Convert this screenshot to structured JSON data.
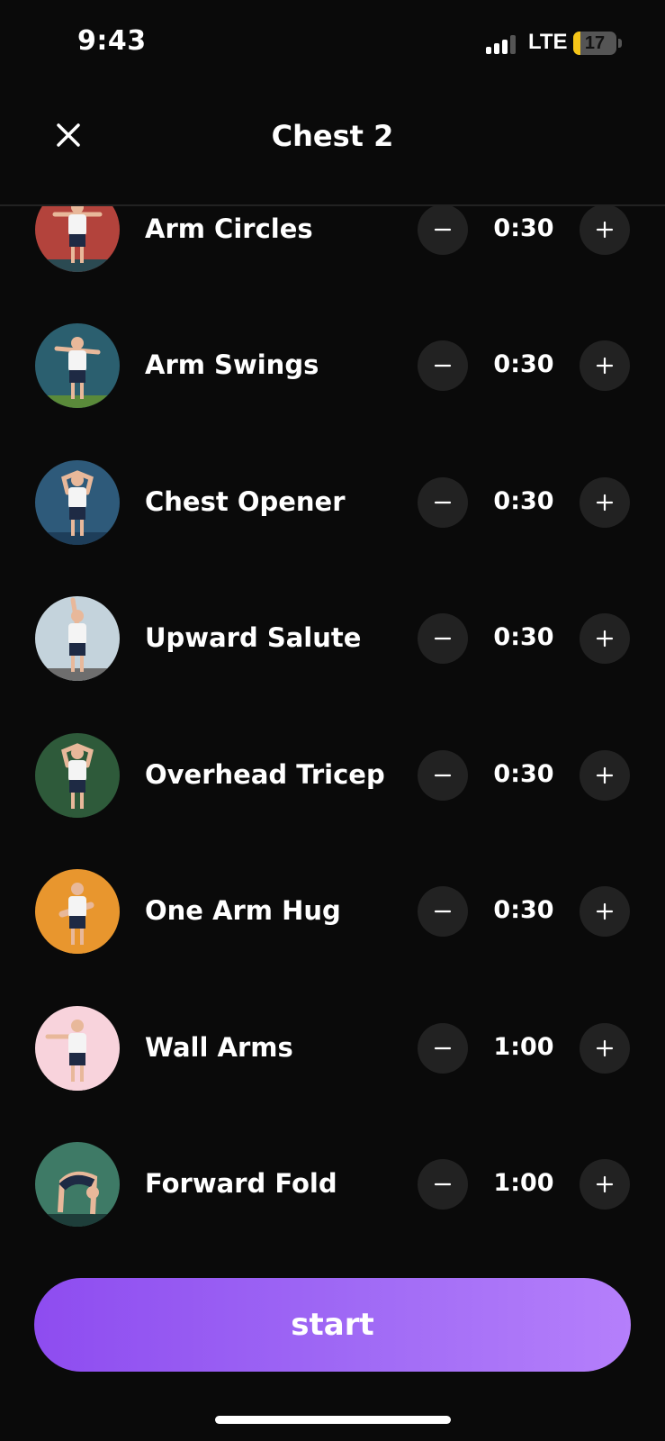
{
  "status_bar": {
    "time": "9:43",
    "network": "LTE",
    "battery": "17"
  },
  "header": {
    "title": "Chest 2"
  },
  "exercises": [
    {
      "name": "Arm Circles",
      "duration": "0:30",
      "avatar_bg": "#b3433c",
      "floor": "#2b4a52"
    },
    {
      "name": "Arm Swings",
      "duration": "0:30",
      "avatar_bg": "#2b5f6f",
      "floor": "#5a8a3a"
    },
    {
      "name": "Chest Opener",
      "duration": "0:30",
      "avatar_bg": "#2e5a7a",
      "floor": "#1e3e5a"
    },
    {
      "name": "Upward Salute",
      "duration": "0:30",
      "avatar_bg": "#c4d3dc",
      "floor": "#6e6e6e"
    },
    {
      "name": "Overhead Tricep",
      "duration": "0:30",
      "avatar_bg": "#2e5a3a",
      "floor": "#2e5a3a"
    },
    {
      "name": "One Arm Hug",
      "duration": "0:30",
      "avatar_bg": "#e8962e",
      "floor": "#e8962e"
    },
    {
      "name": "Wall Arms",
      "duration": "1:00",
      "avatar_bg": "#f8d3dc",
      "floor": "#f8d3dc"
    },
    {
      "name": "Forward Fold",
      "duration": "1:00",
      "avatar_bg": "#3e7a66",
      "floor": "#1e3e3a"
    }
  ],
  "start_label": "start",
  "colors": {
    "accent_start": "#8e4cf0",
    "accent_end": "#b57ffb",
    "background": "#0a0a0a",
    "control_bg": "#222222"
  }
}
